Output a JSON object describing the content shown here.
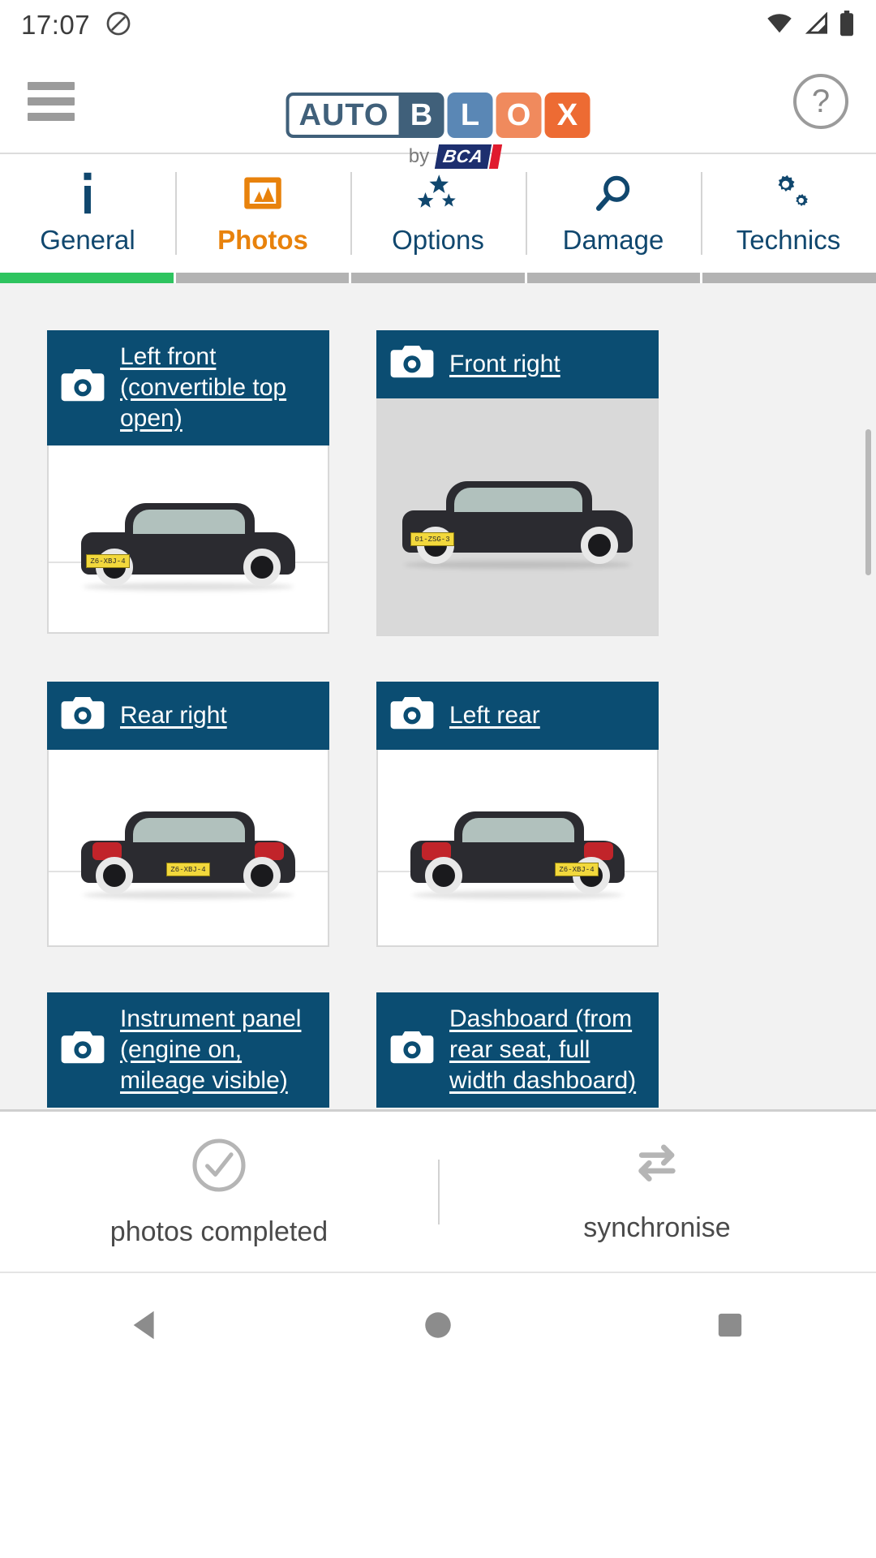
{
  "status_bar": {
    "time": "17:07",
    "icons": [
      "do-not-disturb-icon",
      "wifi-icon",
      "cellular-signal-icon",
      "battery-icon"
    ]
  },
  "header": {
    "menu_icon": "hamburger-menu-icon",
    "help_icon": "help-question-icon",
    "help_label": "?",
    "logo": {
      "auto": "AUTO",
      "tiles": [
        "B",
        "L",
        "O",
        "X"
      ],
      "by": "by",
      "brand": "BCA",
      "colors": {
        "auto_border": "#40607a",
        "tile_b": "#40607a",
        "tile_l": "#5a87b5",
        "tile_o": "#f08a5d",
        "tile_x": "#ed6b33",
        "bca_blue": "#1d2f6f",
        "bca_red": "#e01b2e"
      }
    }
  },
  "tabs": {
    "active_index": 1,
    "accent_color": "#e8820c",
    "inactive_color": "#10476e",
    "items": [
      {
        "label": "General",
        "icon": "info-icon",
        "progress": "done"
      },
      {
        "label": "Photos",
        "icon": "image-icon",
        "progress": "pending"
      },
      {
        "label": "Options",
        "icon": "stars-icon",
        "progress": "pending"
      },
      {
        "label": "Damage",
        "icon": "search-icon",
        "progress": "pending"
      },
      {
        "label": "Technics",
        "icon": "gears-icon",
        "progress": "pending"
      }
    ],
    "progress_done_color": "#2ec45f",
    "progress_pending_color": "#b3b3b3"
  },
  "photos": {
    "card_header_color": "#0b4d72",
    "cards": [
      {
        "title": "Left front (convertible top open)",
        "icon": "camera-icon",
        "plate": "Z6-XBJ-4",
        "view": "front-left",
        "bg": "white"
      },
      {
        "title": "Front right",
        "icon": "camera-icon",
        "plate": "01-ZSG-3",
        "view": "front-right",
        "bg": "gray"
      },
      {
        "title": "Rear right",
        "icon": "camera-icon",
        "plate": "Z6-XBJ-4",
        "view": "rear-right",
        "bg": "white"
      },
      {
        "title": "Left rear",
        "icon": "camera-icon",
        "plate": "Z6-XBJ-4",
        "view": "rear-left",
        "bg": "white"
      },
      {
        "title": "Instrument panel (engine on, mileage visible)",
        "icon": "camera-icon",
        "plate": "",
        "view": "interior",
        "bg": "white"
      },
      {
        "title": "Dashboard (from rear seat, full width dashboard)",
        "icon": "camera-icon",
        "plate": "",
        "view": "interior",
        "bg": "white"
      }
    ]
  },
  "action_bar": {
    "actions": [
      {
        "label": "photos completed",
        "icon": "check-circle-icon"
      },
      {
        "label": "synchronise",
        "icon": "sync-arrows-icon"
      }
    ]
  },
  "nav_bar": {
    "buttons": [
      {
        "name": "back-button",
        "icon": "triangle-back-icon"
      },
      {
        "name": "home-button",
        "icon": "circle-home-icon"
      },
      {
        "name": "recents-button",
        "icon": "square-recents-icon"
      }
    ]
  }
}
